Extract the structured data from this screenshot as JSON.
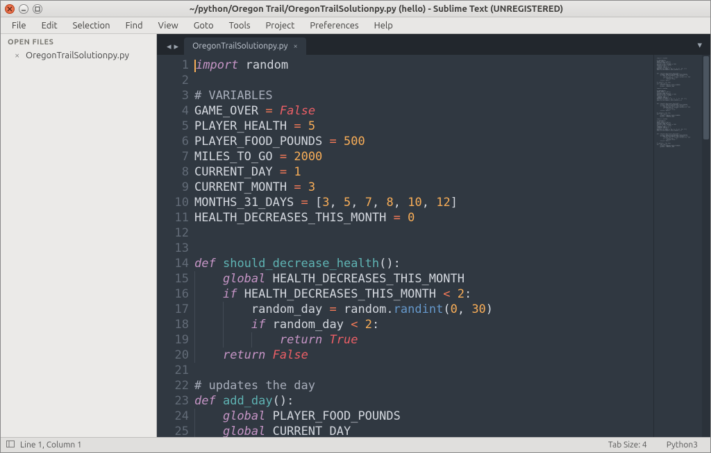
{
  "titlebar": {
    "title": "~/python/Oregon Trail/OregonTrailSolutionpy.py (hello) - Sublime Text (UNREGISTERED)"
  },
  "menubar": {
    "items": [
      "File",
      "Edit",
      "Selection",
      "Find",
      "View",
      "Goto",
      "Tools",
      "Project",
      "Preferences",
      "Help"
    ]
  },
  "sidebar": {
    "header": "OPEN FILES",
    "open_files": [
      {
        "name": "OregonTrailSolutionpy.py"
      }
    ]
  },
  "tabs": {
    "active": "OregonTrailSolutionpy.py"
  },
  "statusbar": {
    "position": "Line 1, Column 1",
    "tabsize": "Tab Size: 4",
    "syntax": "Python3"
  },
  "code": {
    "lines": [
      [
        {
          "t": "kw",
          "s": "import"
        },
        {
          "t": "sp",
          "s": " "
        },
        {
          "t": "var",
          "s": "random"
        }
      ],
      [],
      [
        {
          "t": "comm",
          "s": "# VARIABLES"
        }
      ],
      [
        {
          "t": "var",
          "s": "GAME_OVER"
        },
        {
          "t": "sp",
          "s": " "
        },
        {
          "t": "op",
          "s": "="
        },
        {
          "t": "sp",
          "s": " "
        },
        {
          "t": "const",
          "s": "False"
        }
      ],
      [
        {
          "t": "var",
          "s": "PLAYER_HEALTH"
        },
        {
          "t": "sp",
          "s": " "
        },
        {
          "t": "op",
          "s": "="
        },
        {
          "t": "sp",
          "s": " "
        },
        {
          "t": "num",
          "s": "5"
        }
      ],
      [
        {
          "t": "var",
          "s": "PLAYER_FOOD_POUNDS"
        },
        {
          "t": "sp",
          "s": " "
        },
        {
          "t": "op",
          "s": "="
        },
        {
          "t": "sp",
          "s": " "
        },
        {
          "t": "num",
          "s": "500"
        }
      ],
      [
        {
          "t": "var",
          "s": "MILES_TO_GO"
        },
        {
          "t": "sp",
          "s": " "
        },
        {
          "t": "op",
          "s": "="
        },
        {
          "t": "sp",
          "s": " "
        },
        {
          "t": "num",
          "s": "2000"
        }
      ],
      [
        {
          "t": "var",
          "s": "CURRENT_DAY"
        },
        {
          "t": "sp",
          "s": " "
        },
        {
          "t": "op",
          "s": "="
        },
        {
          "t": "sp",
          "s": " "
        },
        {
          "t": "num",
          "s": "1"
        }
      ],
      [
        {
          "t": "var",
          "s": "CURRENT_MONTH"
        },
        {
          "t": "sp",
          "s": " "
        },
        {
          "t": "op",
          "s": "="
        },
        {
          "t": "sp",
          "s": " "
        },
        {
          "t": "num",
          "s": "3"
        }
      ],
      [
        {
          "t": "var",
          "s": "MONTHS_31_DAYS"
        },
        {
          "t": "sp",
          "s": " "
        },
        {
          "t": "op",
          "s": "="
        },
        {
          "t": "sp",
          "s": " "
        },
        {
          "t": "punc",
          "s": "["
        },
        {
          "t": "num",
          "s": "3"
        },
        {
          "t": "punc",
          "s": ", "
        },
        {
          "t": "num",
          "s": "5"
        },
        {
          "t": "punc",
          "s": ", "
        },
        {
          "t": "num",
          "s": "7"
        },
        {
          "t": "punc",
          "s": ", "
        },
        {
          "t": "num",
          "s": "8"
        },
        {
          "t": "punc",
          "s": ", "
        },
        {
          "t": "num",
          "s": "10"
        },
        {
          "t": "punc",
          "s": ", "
        },
        {
          "t": "num",
          "s": "12"
        },
        {
          "t": "punc",
          "s": "]"
        }
      ],
      [
        {
          "t": "var",
          "s": "HEALTH_DECREASES_THIS_MONTH"
        },
        {
          "t": "sp",
          "s": " "
        },
        {
          "t": "op",
          "s": "="
        },
        {
          "t": "sp",
          "s": " "
        },
        {
          "t": "num",
          "s": "0"
        }
      ],
      [],
      [],
      [
        {
          "t": "kw",
          "s": "def"
        },
        {
          "t": "sp",
          "s": " "
        },
        {
          "t": "fn",
          "s": "should_decrease_health"
        },
        {
          "t": "punc",
          "s": "():"
        }
      ],
      [
        {
          "t": "indent",
          "s": "    "
        },
        {
          "t": "kw",
          "s": "global"
        },
        {
          "t": "sp",
          "s": " "
        },
        {
          "t": "var",
          "s": "HEALTH_DECREASES_THIS_MONTH"
        }
      ],
      [
        {
          "t": "indent",
          "s": "    "
        },
        {
          "t": "kw",
          "s": "if"
        },
        {
          "t": "sp",
          "s": " "
        },
        {
          "t": "var",
          "s": "HEALTH_DECREASES_THIS_MONTH"
        },
        {
          "t": "sp",
          "s": " "
        },
        {
          "t": "op",
          "s": "<"
        },
        {
          "t": "sp",
          "s": " "
        },
        {
          "t": "num",
          "s": "2"
        },
        {
          "t": "punc",
          "s": ":"
        }
      ],
      [
        {
          "t": "indent",
          "s": "        "
        },
        {
          "t": "var",
          "s": "random_day"
        },
        {
          "t": "sp",
          "s": " "
        },
        {
          "t": "op",
          "s": "="
        },
        {
          "t": "sp",
          "s": " "
        },
        {
          "t": "var",
          "s": "random"
        },
        {
          "t": "punc",
          "s": "."
        },
        {
          "t": "call",
          "s": "randint"
        },
        {
          "t": "punc",
          "s": "("
        },
        {
          "t": "num",
          "s": "0"
        },
        {
          "t": "punc",
          "s": ", "
        },
        {
          "t": "num",
          "s": "30"
        },
        {
          "t": "punc",
          "s": ")"
        }
      ],
      [
        {
          "t": "indent",
          "s": "        "
        },
        {
          "t": "kw",
          "s": "if"
        },
        {
          "t": "sp",
          "s": " "
        },
        {
          "t": "var",
          "s": "random_day"
        },
        {
          "t": "sp",
          "s": " "
        },
        {
          "t": "op",
          "s": "<"
        },
        {
          "t": "sp",
          "s": " "
        },
        {
          "t": "num",
          "s": "2"
        },
        {
          "t": "punc",
          "s": ":"
        }
      ],
      [
        {
          "t": "indent",
          "s": "            "
        },
        {
          "t": "kw",
          "s": "return"
        },
        {
          "t": "sp",
          "s": " "
        },
        {
          "t": "const",
          "s": "True"
        }
      ],
      [
        {
          "t": "indent",
          "s": "    "
        },
        {
          "t": "kw",
          "s": "return"
        },
        {
          "t": "sp",
          "s": " "
        },
        {
          "t": "const",
          "s": "False"
        }
      ],
      [],
      [
        {
          "t": "comm",
          "s": "# updates the day"
        }
      ],
      [
        {
          "t": "kw",
          "s": "def"
        },
        {
          "t": "sp",
          "s": " "
        },
        {
          "t": "fn",
          "s": "add_day"
        },
        {
          "t": "punc",
          "s": "():"
        }
      ],
      [
        {
          "t": "indent",
          "s": "    "
        },
        {
          "t": "kw",
          "s": "global"
        },
        {
          "t": "sp",
          "s": " "
        },
        {
          "t": "var",
          "s": "PLAYER_FOOD_POUNDS"
        }
      ],
      [
        {
          "t": "indent",
          "s": "    "
        },
        {
          "t": "kw",
          "s": "global"
        },
        {
          "t": "sp",
          "s": " "
        },
        {
          "t": "var",
          "s": "CURRENT_DAY"
        }
      ]
    ]
  }
}
